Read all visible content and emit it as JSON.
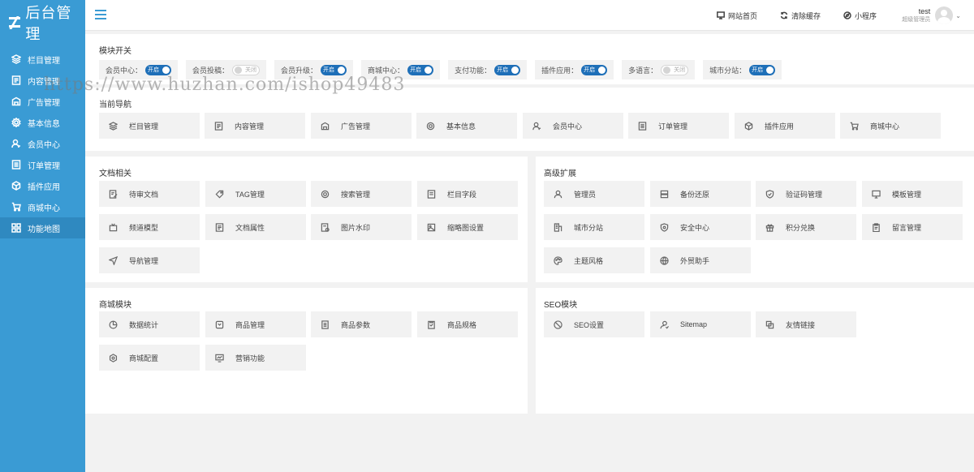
{
  "logo": {
    "text": "后台管理"
  },
  "sidebar": {
    "items": [
      {
        "label": "栏目管理",
        "icon": "layers-icon"
      },
      {
        "label": "内容管理",
        "icon": "document-icon"
      },
      {
        "label": "广告管理",
        "icon": "ad-icon"
      },
      {
        "label": "基本信息",
        "icon": "gear-icon"
      },
      {
        "label": "会员中心",
        "icon": "user-icon"
      },
      {
        "label": "订单管理",
        "icon": "list-icon"
      },
      {
        "label": "插件应用",
        "icon": "cube-icon"
      },
      {
        "label": "商城中心",
        "icon": "cart-icon"
      },
      {
        "label": "功能地图",
        "icon": "grid-icon"
      }
    ]
  },
  "topbar": {
    "links": [
      {
        "label": "网站首页",
        "icon": "monitor-icon"
      },
      {
        "label": "清除缓存",
        "icon": "refresh-icon"
      },
      {
        "label": "小程序",
        "icon": "compass-icon"
      }
    ],
    "user": {
      "name": "test",
      "role": "超级管理员"
    }
  },
  "modules": {
    "title": "模块开关",
    "switches": [
      {
        "label": "会员中心：",
        "state": "开启",
        "on": true
      },
      {
        "label": "会员投稿：",
        "state": "关闭",
        "on": false
      },
      {
        "label": "会员升级：",
        "state": "开启",
        "on": true
      },
      {
        "label": "商城中心：",
        "state": "开启",
        "on": true
      },
      {
        "label": "支付功能：",
        "state": "开启",
        "on": true
      },
      {
        "label": "插件应用：",
        "state": "开启",
        "on": true
      },
      {
        "label": "多语言：",
        "state": "关闭",
        "on": false
      },
      {
        "label": "城市分站：",
        "state": "开启",
        "on": true
      }
    ]
  },
  "current_nav": {
    "title": "当前导航",
    "items": [
      {
        "label": "栏目管理",
        "icon": "layers-icon"
      },
      {
        "label": "内容管理",
        "icon": "document-icon"
      },
      {
        "label": "广告管理",
        "icon": "ad-icon"
      },
      {
        "label": "基本信息",
        "icon": "gear-icon"
      },
      {
        "label": "会员中心",
        "icon": "user-icon"
      },
      {
        "label": "订单管理",
        "icon": "list-icon"
      },
      {
        "label": "插件应用",
        "icon": "cube-icon"
      },
      {
        "label": "商城中心",
        "icon": "cart-icon"
      }
    ]
  },
  "docs": {
    "title": "文档相关",
    "items": [
      {
        "label": "待审文档",
        "icon": "edit-doc-icon"
      },
      {
        "label": "TAG管理",
        "icon": "tag-icon"
      },
      {
        "label": "搜索管理",
        "icon": "search-icon"
      },
      {
        "label": "栏目字段",
        "icon": "fields-icon"
      },
      {
        "label": "频道模型",
        "icon": "tv-icon"
      },
      {
        "label": "文档属性",
        "icon": "document-icon"
      },
      {
        "label": "图片水印",
        "icon": "image-doc-icon"
      },
      {
        "label": "缩略图设置",
        "icon": "image-icon"
      },
      {
        "label": "导航管理",
        "icon": "send-icon"
      }
    ]
  },
  "advanced": {
    "title": "高级扩展",
    "items": [
      {
        "label": "管理员",
        "icon": "user-icon"
      },
      {
        "label": "备份还原",
        "icon": "database-icon"
      },
      {
        "label": "验证码管理",
        "icon": "shield-icon"
      },
      {
        "label": "模板管理",
        "icon": "monitor-icon"
      },
      {
        "label": "城市分站",
        "icon": "building-icon"
      },
      {
        "label": "安全中心",
        "icon": "shield-check-icon"
      },
      {
        "label": "积分兑换",
        "icon": "gift-icon"
      },
      {
        "label": "留言管理",
        "icon": "clipboard-icon"
      },
      {
        "label": "主题风格",
        "icon": "palette-icon"
      },
      {
        "label": "外贸助手",
        "icon": "globe-icon"
      }
    ]
  },
  "mall": {
    "title": "商城模块",
    "items": [
      {
        "label": "数据统计",
        "icon": "pie-chart-icon"
      },
      {
        "label": "商品管理",
        "icon": "box-icon"
      },
      {
        "label": "商品参数",
        "icon": "list-icon"
      },
      {
        "label": "商品规格",
        "icon": "spec-icon"
      },
      {
        "label": "商城配置",
        "icon": "gear-icon"
      },
      {
        "label": "营销功能",
        "icon": "marketing-icon"
      }
    ]
  },
  "seo": {
    "title": "SEO模块",
    "items": [
      {
        "label": "SEO设置",
        "icon": "seo-icon"
      },
      {
        "label": "Sitemap",
        "icon": "sitemap-icon"
      },
      {
        "label": "友情链接",
        "icon": "link-icon"
      }
    ]
  },
  "watermark": {
    "text": "https://www.huzhan.com/ishop49483"
  },
  "colors": {
    "sidebar": "#3a9bd4",
    "toggle_on": "#1e6fb8",
    "tile_bg": "#f2f2f2"
  }
}
